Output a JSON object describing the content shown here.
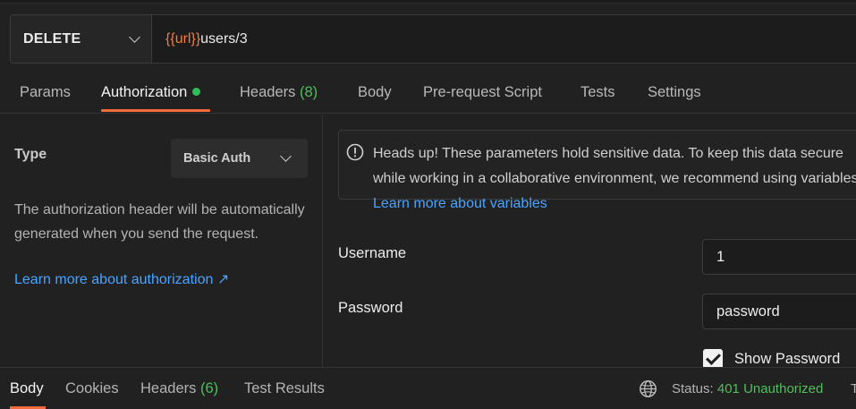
{
  "request": {
    "method": "DELETE",
    "url_variable": "{{url}}",
    "url_path": "users/3"
  },
  "tabs": {
    "params": "Params",
    "authorization": "Authorization",
    "headers": "Headers",
    "headers_count": "(8)",
    "body": "Body",
    "prerequest": "Pre-request Script",
    "tests": "Tests",
    "settings": "Settings"
  },
  "auth": {
    "type_label": "Type",
    "type_value": "Basic Auth",
    "description": "The authorization header will be automatically generated when you send the request.",
    "learn_more": "Learn more about authorization ↗"
  },
  "callout": {
    "text": "Heads up! These parameters hold sensitive data. To keep this data secure while working in a collaborative environment, we recommend using variables.",
    "link": "Learn more about variables"
  },
  "fields": {
    "username_label": "Username",
    "username_value": "1",
    "password_label": "Password",
    "password_value": "password",
    "show_password_label": "Show Password"
  },
  "response": {
    "body": "Body",
    "cookies": "Cookies",
    "headers": "Headers",
    "headers_count": "(6)",
    "test_results": "Test Results",
    "status_label": "Status:",
    "status_value": "401 Unauthorized",
    "tail": "T"
  },
  "colors": {
    "accent": "#f26b3a",
    "success": "#4fbf5a",
    "link": "#4aa3ff",
    "variable": "#f07f45"
  },
  "icons": [
    "chevron-down-icon",
    "info-icon",
    "checkbox-icon",
    "globe-icon"
  ]
}
